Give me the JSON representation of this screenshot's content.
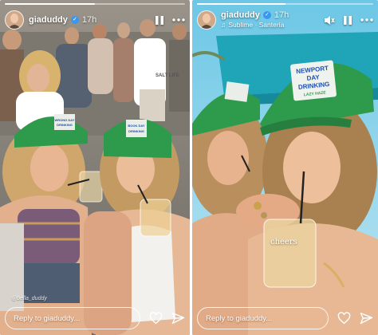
{
  "stories": [
    {
      "username": "giaduddy",
      "time": "17h",
      "music": "",
      "reply_placeholder": "Reply to giaduddy...",
      "watermark": "@bella_duddy",
      "hat_left": "WRONG DAY DRINKING",
      "hat_right": "BOOK DAY DRINKING",
      "shirt_text": "SALT LIFE",
      "progress": 0.5
    },
    {
      "username": "giaduddy",
      "time": "17h",
      "music": "Sublime · Santeria",
      "reply_placeholder": "Reply to giaduddy...",
      "sticker_text": "cheers",
      "hat_text_line1": "NEWPORT",
      "hat_text_line2": "DAY",
      "hat_text_line3": "DRINKING",
      "hat_text_line4": "LAZY HAZE",
      "progress": 0.5
    }
  ],
  "icons": {
    "verified": "verified-badge",
    "pause": "pause-icon",
    "more": "more-icon",
    "mute": "mute-icon",
    "music": "music-note-icon",
    "like": "heart-icon",
    "share": "paper-plane-icon"
  },
  "colors": {
    "hat_green": "#2e9a4c",
    "sky_blue": "#34b3d8",
    "umbrella_teal": "#1fa4b8",
    "verified_blue": "#3897f0"
  }
}
